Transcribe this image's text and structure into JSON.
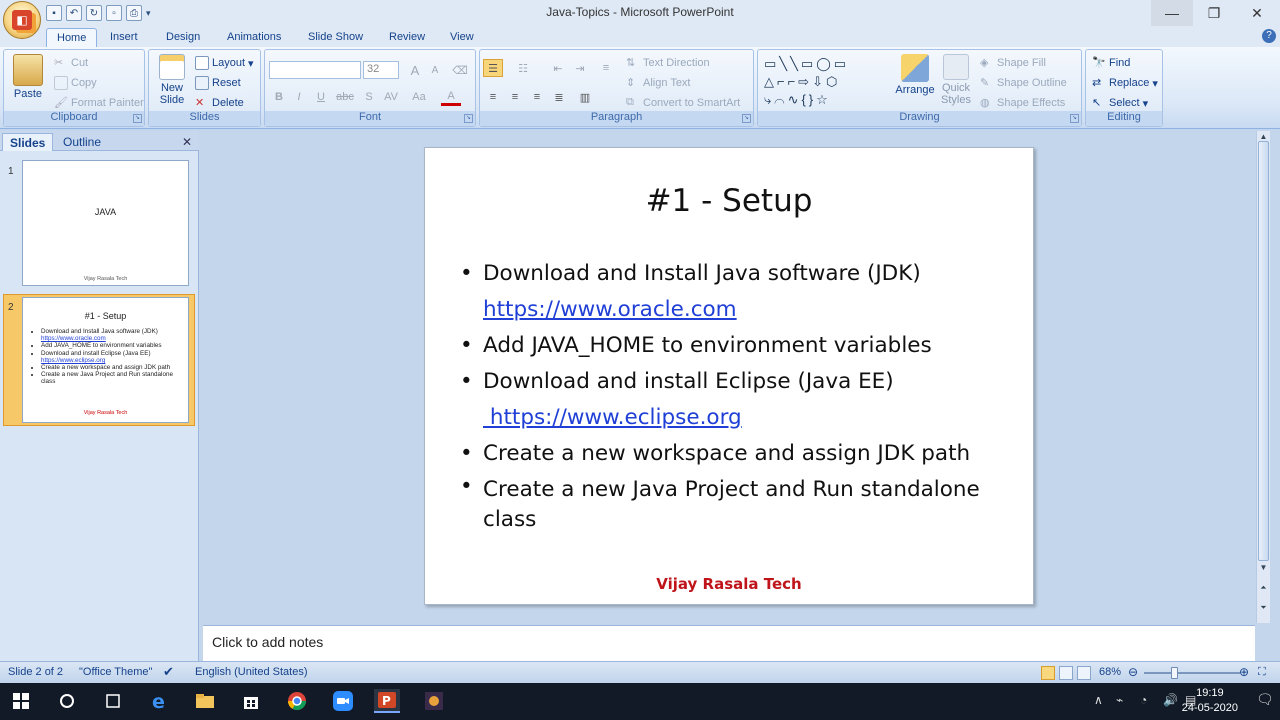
{
  "window": {
    "title": "Java-Topics - Microsoft PowerPoint",
    "min_icon": "minimize-icon",
    "max_icon": "restore-icon",
    "close_icon": "close-icon"
  },
  "ribbon_tabs": [
    "Home",
    "Insert",
    "Design",
    "Animations",
    "Slide Show",
    "Review",
    "View"
  ],
  "ribbon": {
    "clipboard": {
      "label": "Clipboard",
      "paste": "Paste",
      "cut": "Cut",
      "copy": "Copy",
      "format_painter": "Format Painter"
    },
    "slides": {
      "label": "Slides",
      "new_slide_1": "New",
      "new_slide_2": "Slide",
      "layout": "Layout",
      "reset": "Reset",
      "delete": "Delete"
    },
    "font": {
      "label": "Font",
      "font_size": "32",
      "bold": "B",
      "italic": "I",
      "underline": "U",
      "strike": "abc",
      "shadow": "S",
      "spacing": "AV",
      "case": "Aa",
      "color": "A",
      "grow": "A",
      "shrink": "A"
    },
    "paragraph": {
      "label": "Paragraph",
      "text_direction": "Text Direction",
      "align_text": "Align Text",
      "convert_smartart": "Convert to SmartArt"
    },
    "drawing": {
      "label": "Drawing",
      "arrange": "Arrange",
      "quick_styles_1": "Quick",
      "quick_styles_2": "Styles",
      "shape_fill": "Shape Fill",
      "shape_outline": "Shape Outline",
      "shape_effects": "Shape Effects"
    },
    "editing": {
      "label": "Editing",
      "find": "Find",
      "replace": "Replace",
      "select": "Select"
    }
  },
  "slides_pane": {
    "tabs": [
      "Slides",
      "Outline"
    ],
    "thumbs": [
      {
        "number": "1",
        "title": "JAVA",
        "footer": "Vijay Rasala Tech"
      },
      {
        "number": "2",
        "title": "#1 - Setup",
        "footer": "Vijay Rasala Tech"
      }
    ]
  },
  "slide": {
    "title": "#1 - Setup",
    "bullets": [
      {
        "text": "Download and Install Java software (JDK)",
        "link": "https://www.oracle.com"
      },
      {
        "text": "Add JAVA_HOME to environment variables",
        "link": ""
      },
      {
        "text": "Download and install Eclipse (Java EE)",
        "link": " https://www.eclipse.org"
      },
      {
        "text": "Create a new workspace and assign JDK path",
        "link": ""
      },
      {
        "text": "Create a new Java Project and Run standalone",
        "continuation": "class"
      }
    ],
    "footer": "Vijay Rasala Tech"
  },
  "notes": {
    "placeholder": "Click to add notes"
  },
  "status": {
    "slide": "Slide 2 of 2",
    "theme": "\"Office Theme\"",
    "language": "English (United States)",
    "zoom": "68%"
  },
  "taskbar": {
    "time": "19:19",
    "date": "24-05-2020"
  },
  "colors": {
    "link": "#1f3fd6",
    "footer_red": "#c0141b",
    "ribbon_blue": "#15428b"
  }
}
